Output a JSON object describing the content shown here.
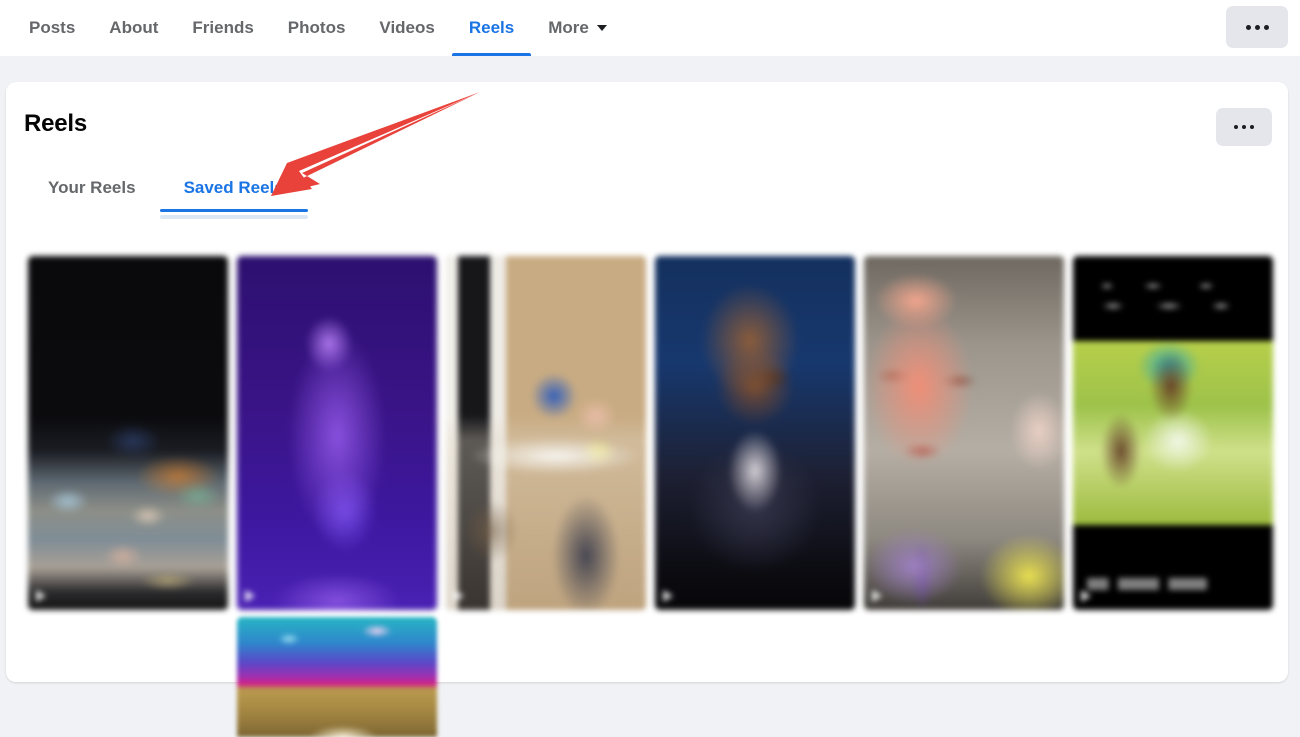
{
  "topnav": {
    "tabs": [
      {
        "label": "Posts",
        "active": false
      },
      {
        "label": "About",
        "active": false
      },
      {
        "label": "Friends",
        "active": false
      },
      {
        "label": "Photos",
        "active": false
      },
      {
        "label": "Videos",
        "active": false
      },
      {
        "label": "Reels",
        "active": true
      },
      {
        "label": "More",
        "active": false,
        "has_caret": true
      }
    ],
    "more_options_button": "•••"
  },
  "card": {
    "title": "Reels",
    "options_button": "•••",
    "subtabs": [
      {
        "label": "Your Reels",
        "active": false
      },
      {
        "label": "Saved Reels",
        "active": true
      }
    ]
  },
  "reels": [
    {
      "id": "reel-1",
      "description": "dark concert scene with blurred crowd"
    },
    {
      "id": "reel-2",
      "description": "purple stage with dancing figure"
    },
    {
      "id": "reel-3",
      "description": "indoor kitchen scene with blue object"
    },
    {
      "id": "reel-4",
      "description": "man in dark suit on blue background"
    },
    {
      "id": "reel-5",
      "description": "close-up face with purple shirt"
    },
    {
      "id": "reel-6",
      "description": "letterboxed green video with captions"
    },
    {
      "id": "reel-7",
      "description": "galaxy gradient partial thumbnail"
    }
  ],
  "colors": {
    "accent_blue": "#1b74e4",
    "page_background": "#f0f2f5",
    "card_background": "#ffffff",
    "text_secondary": "#65676b",
    "text_primary": "#050505",
    "button_grey": "#e4e6eb",
    "annotation_red": "#e8423a"
  },
  "annotation": {
    "type": "arrow",
    "points_to": "Saved Reels",
    "color": "#e8423a"
  }
}
